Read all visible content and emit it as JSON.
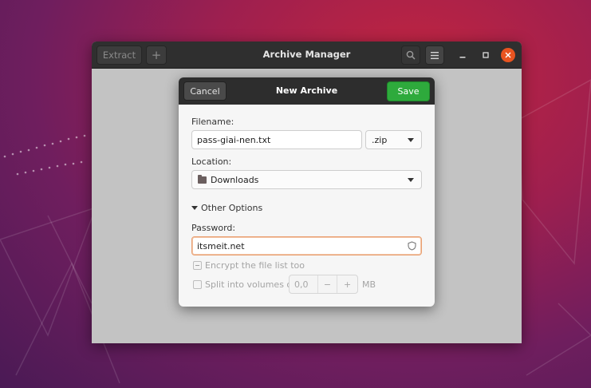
{
  "colors": {
    "accent": "#e95420",
    "save_button": "#2eaa3c",
    "headerbar": "#2f2f2f",
    "dialog_bg": "#f6f6f6"
  },
  "window": {
    "title": "Archive Manager",
    "extract_label": "Extract",
    "add_icon": "plus-icon",
    "search_icon": "search-icon",
    "menu_icon": "hamburger-menu-icon",
    "minimize_icon": "minimize-icon",
    "maximize_icon": "maximize-icon",
    "close_icon": "close-icon"
  },
  "dialog": {
    "title": "New Archive",
    "cancel_label": "Cancel",
    "save_label": "Save",
    "filename_label": "Filename:",
    "filename_value": "pass-giai-nen.txt",
    "extension_value": ".zip",
    "location_label": "Location:",
    "location_value": "Downloads",
    "location_icon": "folder-icon",
    "other_options_label": "Other Options",
    "password_label": "Password:",
    "password_value": "itsmeit.net",
    "password_icon": "shield-icon",
    "encrypt_label": "Encrypt the file list too",
    "split_label": "Split into volumes of",
    "volume_value": "0,0",
    "volume_decrement": "−",
    "volume_increment": "+",
    "volume_unit": "MB"
  }
}
